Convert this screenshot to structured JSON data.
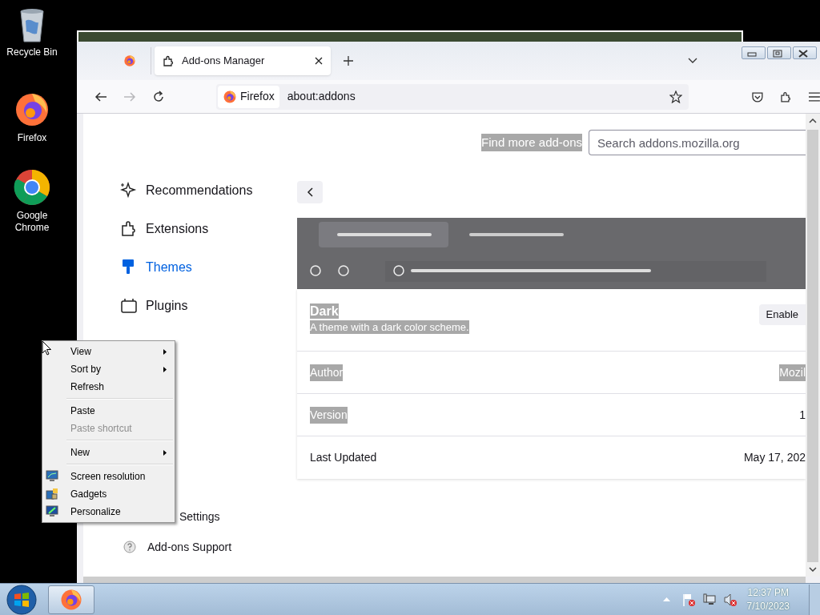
{
  "desktop_icons": [
    {
      "kind": "recycle",
      "label": "Recycle Bin"
    },
    {
      "kind": "firefox",
      "label": "Firefox"
    },
    {
      "kind": "chrome",
      "label": "Google Chrome"
    }
  ],
  "browser": {
    "tabs": [
      {
        "label": "Add-ons Manager",
        "selected": true
      }
    ],
    "nav_buttons": [
      {
        "kind": "back",
        "disabled": false
      },
      {
        "kind": "forward",
        "disabled": true
      },
      {
        "kind": "reload",
        "disabled": false
      }
    ],
    "identity": "Firefox",
    "url": "about:addons"
  },
  "addons": {
    "find_more": {
      "text": "Find more add-ons",
      "highlighted": true
    },
    "search": {
      "placeholder": "Search addons.mozilla.org"
    },
    "sidebar": [
      {
        "kind": "recommendations",
        "label": "Recommendations",
        "selected": false
      },
      {
        "kind": "extensions",
        "label": "Extensions",
        "selected": false
      },
      {
        "kind": "themes",
        "label": "Themes",
        "selected": true
      },
      {
        "kind": "plugins",
        "label": "Plugins",
        "selected": false
      }
    ],
    "footer": [
      {
        "kind": "settings",
        "label": "Settings"
      },
      {
        "kind": "support",
        "label": "Add-ons Support"
      }
    ],
    "theme": {
      "name": {
        "text": "Dark",
        "highlighted": true
      },
      "description": {
        "text": "A theme with a dark color scheme.",
        "highlighted": true
      },
      "button": "Enable",
      "details": [
        {
          "label": {
            "text": "Author",
            "highlighted": true
          },
          "value": {
            "text": "Mozil",
            "highlighted": true
          }
        },
        {
          "label": {
            "text": "Version",
            "highlighted": true
          },
          "value": {
            "text": "1",
            "highlighted": false
          }
        },
        {
          "label": {
            "text": "Last Updated",
            "highlighted": false
          },
          "value": {
            "text": "May 17, 202",
            "highlighted": false
          }
        }
      ]
    }
  },
  "context_menu": [
    [
      {
        "label": "View",
        "submenu": true,
        "disabled": false
      },
      {
        "label": "Sort by",
        "submenu": true,
        "disabled": false
      },
      {
        "label": "Refresh",
        "submenu": false,
        "disabled": false
      }
    ],
    [
      {
        "label": "Paste",
        "submenu": false,
        "disabled": false
      },
      {
        "label": "Paste shortcut",
        "submenu": false,
        "disabled": true
      }
    ],
    [
      {
        "label": "New",
        "submenu": true,
        "disabled": false
      }
    ],
    [
      {
        "label": "Screen resolution",
        "kind": "display",
        "submenu": false,
        "disabled": false
      },
      {
        "label": "Gadgets",
        "kind": "gadgets",
        "submenu": false,
        "disabled": false
      },
      {
        "label": "Personalize",
        "kind": "personalize",
        "submenu": false,
        "disabled": false
      }
    ]
  ],
  "taskbar": {
    "time": "12:37 PM",
    "date": "7/10/2023"
  }
}
